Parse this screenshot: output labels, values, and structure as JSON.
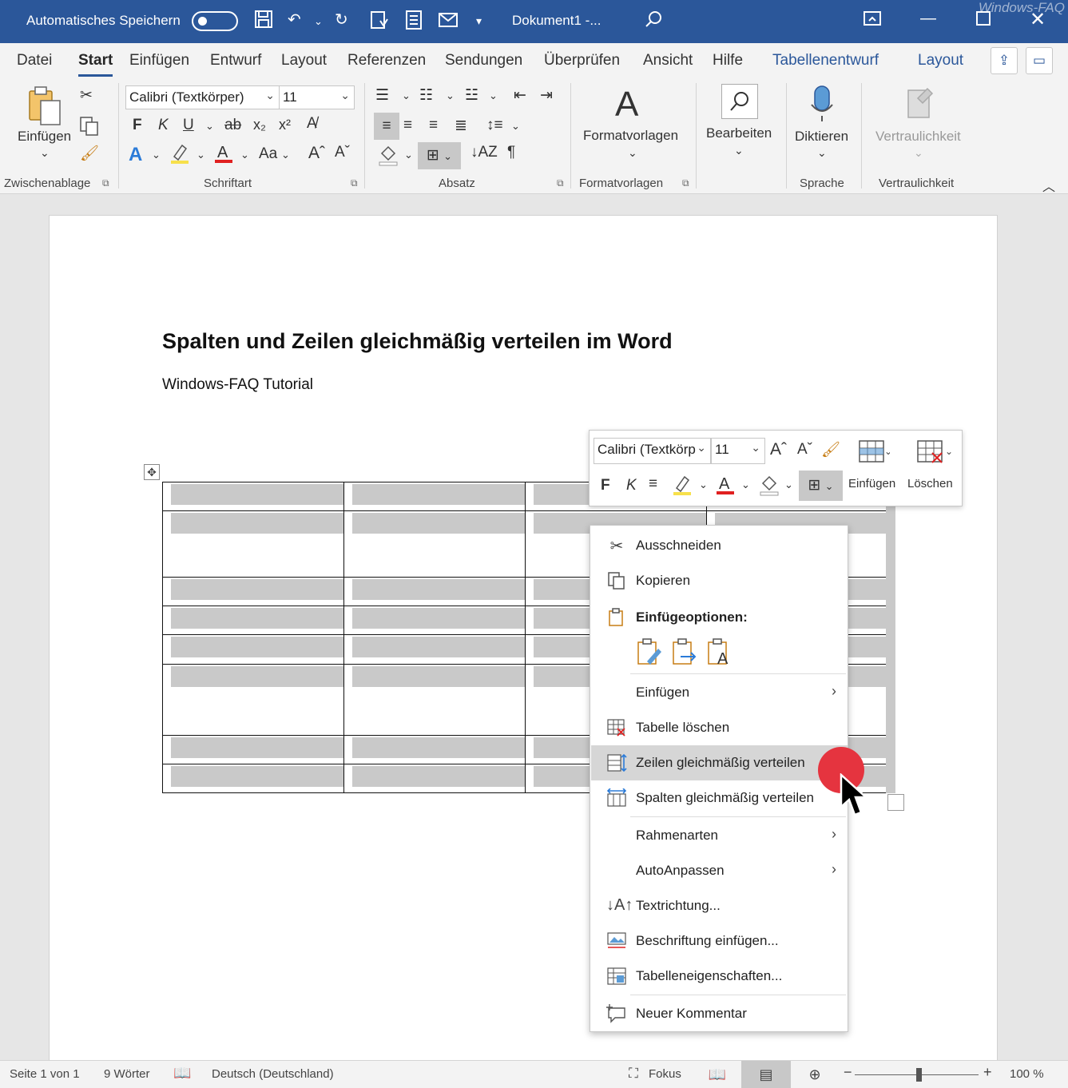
{
  "titlebar": {
    "autosave_label": "Automatisches Speichern",
    "document_title": "Dokument1  -...",
    "brand": "Windows-FAQ"
  },
  "tabs": {
    "items": [
      "Datei",
      "Start",
      "Einfügen",
      "Entwurf",
      "Layout",
      "Referenzen",
      "Sendungen",
      "Überprüfen",
      "Ansicht",
      "Hilfe"
    ],
    "context_items": [
      "Tabellenentwurf",
      "Layout"
    ],
    "active": "Start"
  },
  "ribbon": {
    "clipboard": {
      "paste_label": "Einfügen",
      "group_label": "Zwischenablage"
    },
    "font": {
      "font_name": "Calibri (Textkörper)",
      "font_size": "11",
      "bold": "F",
      "italic": "K",
      "underline": "U",
      "strike": "ab",
      "sub": "x₂",
      "sup": "x²",
      "grow": "A^",
      "shrink": "Aˇ",
      "case": "Aa",
      "group_label": "Schriftart"
    },
    "paragraph": {
      "group_label": "Absatz",
      "pilcrow": "¶"
    },
    "styles": {
      "label": "Formatvorlagen",
      "group_label": "Formatvorlagen"
    },
    "editing": {
      "label": "Bearbeiten"
    },
    "voice": {
      "label": "Diktieren",
      "group_label": "Sprache"
    },
    "sensitivity": {
      "label": "Vertraulichkeit",
      "group_label": "Vertraulichkeit"
    }
  },
  "document": {
    "title": "Spalten und Zeilen gleichmäßig verteilen im Word",
    "subtitle": "Windows-FAQ Tutorial"
  },
  "minitoolbar": {
    "font_name": "Calibri (Textkörp",
    "font_size": "11",
    "bold": "F",
    "italic": "K",
    "insert_label": "Einfügen",
    "delete_label": "Löschen"
  },
  "context_menu": {
    "items": [
      {
        "label": "Ausschneiden",
        "icon": "scissors-icon"
      },
      {
        "label": "Kopieren",
        "icon": "copy-icon"
      },
      {
        "label": "Einfügeoptionen:",
        "icon": "paste-icon"
      },
      {
        "label": "Einfügen",
        "icon": ""
      },
      {
        "label": "Tabelle löschen",
        "icon": "delete-table-icon"
      },
      {
        "label": "Zeilen gleichmäßig verteilen",
        "icon": "distribute-rows-icon"
      },
      {
        "label": "Spalten gleichmäßig verteilen",
        "icon": "distribute-columns-icon"
      },
      {
        "label": "Rahmenarten",
        "icon": ""
      },
      {
        "label": "AutoAnpassen",
        "icon": ""
      },
      {
        "label": "Textrichtung...",
        "icon": "text-direction-icon"
      },
      {
        "label": "Beschriftung einfügen...",
        "icon": "caption-icon"
      },
      {
        "label": "Tabelleneigenschaften...",
        "icon": "table-properties-icon"
      },
      {
        "label": "Neuer Kommentar",
        "icon": "comment-icon"
      }
    ],
    "hovered": "Zeilen gleichmäßig verteilen"
  },
  "statusbar": {
    "page": "Seite 1 von 1",
    "words": "9 Wörter",
    "language": "Deutsch (Deutschland)",
    "focus": "Fokus",
    "zoom_minus": "−",
    "zoom_plus": "+",
    "zoom": "100 %"
  },
  "colors": {
    "titlebar": "#2b579a",
    "accent": "#2b579a",
    "click_dot": "#e5343f",
    "font_color_bar": "#e02020",
    "highlight_bar": "#f7e04b"
  }
}
